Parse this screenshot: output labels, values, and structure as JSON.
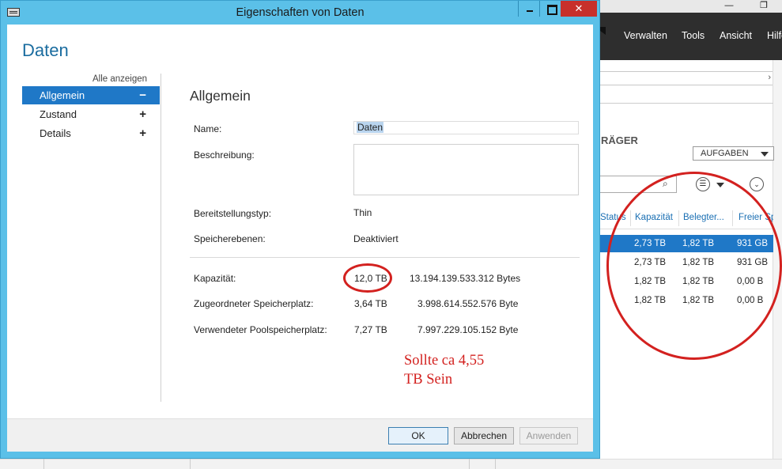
{
  "background_app": {
    "menu": [
      "Verwalten",
      "Tools",
      "Ansicht",
      "Hilfe"
    ],
    "section_title": "RÄGER",
    "tasks_label": "AUFGABEN",
    "columns": [
      "Status",
      "Kapazität",
      "Belegter...",
      "Freier Sp"
    ],
    "rows": [
      {
        "capacity": "2,73 TB",
        "used": "1,82 TB",
        "free": "931 GB",
        "selected": true
      },
      {
        "capacity": "2,73 TB",
        "used": "1,82 TB",
        "free": "931 GB",
        "selected": false
      },
      {
        "capacity": "1,82 TB",
        "used": "1,82 TB",
        "free": "0,00 B",
        "selected": false
      },
      {
        "capacity": "1,82 TB",
        "used": "1,82 TB",
        "free": "0,00 B",
        "selected": false
      }
    ]
  },
  "dialog": {
    "title": "Eigenschaften von Daten",
    "heading": "Daten",
    "nav": {
      "show_all": "Alle anzeigen",
      "items": [
        {
          "label": "Allgemein",
          "sign": "−"
        },
        {
          "label": "Zustand",
          "sign": "+"
        },
        {
          "label": "Details",
          "sign": "+"
        }
      ]
    },
    "section_title": "Allgemein",
    "fields": {
      "name_label": "Name:",
      "name_value": "Daten",
      "description_label": "Beschreibung:",
      "provisioning_label": "Bereitstellungstyp:",
      "provisioning_value": "Thin",
      "tiers_label": "Speicherebenen:",
      "tiers_value": "Deaktiviert",
      "capacity_label": "Kapazität:",
      "capacity_value": "12,0 TB",
      "capacity_bytes": "13.194.139.533.312 Bytes",
      "allocated_label": "Zugeordneter Speicherplatz:",
      "allocated_value": "3,64 TB",
      "allocated_bytes": "3.998.614.552.576 Byte",
      "pool_label": "Verwendeter Poolspeicherplatz:",
      "pool_value": "7,27 TB",
      "pool_bytes": "7.997.229.105.152 Byte"
    },
    "annotation": {
      "line1": "Sollte ca 4,55",
      "line2": "TB Sein",
      "color": "#d3211f"
    },
    "buttons": {
      "ok": "OK",
      "cancel": "Abbrechen",
      "apply": "Anwenden"
    }
  },
  "icons": {
    "close": "✕",
    "search": "⌕",
    "list": "☰",
    "expand": "⌄",
    "chevron_right": "›"
  },
  "colors": {
    "title_bar": "#5bc0e8",
    "accent": "#1f78c7",
    "heading": "#1a6c9f",
    "close_button": "#c7302b",
    "annotation": "#d3211f"
  }
}
